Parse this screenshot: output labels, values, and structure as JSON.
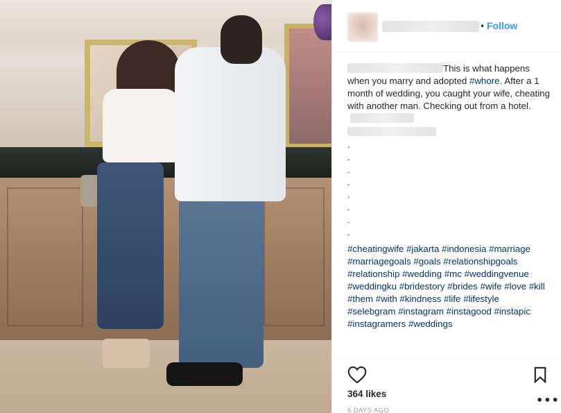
{
  "post": {
    "photo_alt": "hotel-reception-photo",
    "follow_label": "Follow",
    "separator": "•",
    "caption": {
      "line1_text": "This is what happens when you marry and adopted ",
      "hashtag_whore": "#whore",
      "line2_text": ". After a 1 month of wedding, you caught your wife, cheating with another man. Checking out from a hotel.",
      "dots": [
        ".",
        ".",
        ".",
        ".",
        ".",
        ".",
        ".",
        "."
      ],
      "hashtags": [
        "#cheatingwife",
        "#jakarta",
        "#indonesia",
        "#marriage",
        "#marriagegoals",
        "#goals",
        "#relationshipgoals",
        "#relationship",
        "#wedding",
        "#mc",
        "#weddingvenue",
        "#weddingku",
        "#bridestory",
        "#brides",
        "#wife",
        "#love",
        "#kill",
        "#them",
        "#with",
        "#kindness",
        "#life",
        "#lifestyle",
        "#selebgram",
        "#instagram",
        "#instagood",
        "#instapic",
        "#instagramers",
        "#weddings"
      ]
    },
    "likes": "364 likes",
    "time_ago": "6 DAYS AGO",
    "more_label": "•••"
  },
  "icons": {
    "like": "heart-icon",
    "save": "bookmark-icon",
    "more": "more-options-icon"
  },
  "colors": {
    "link": "#3897f0",
    "hashtag": "#003569",
    "muted": "#999999"
  }
}
